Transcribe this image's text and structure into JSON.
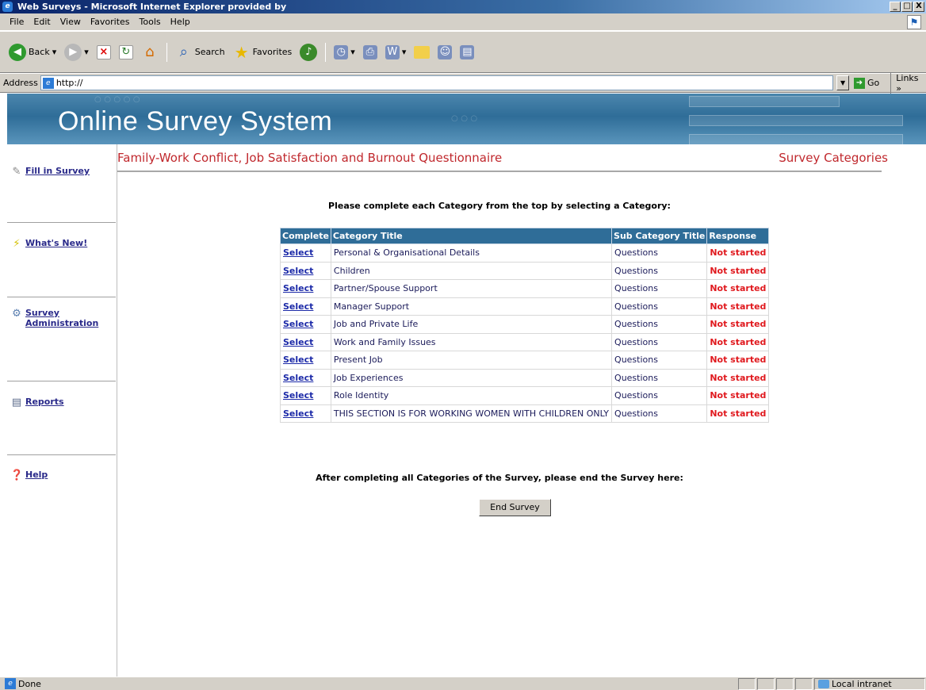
{
  "window": {
    "title": "Web Surveys - Microsoft Internet Explorer provided by",
    "controls": [
      "_",
      "□",
      "X"
    ]
  },
  "menu": [
    "File",
    "Edit",
    "View",
    "Favorites",
    "Tools",
    "Help"
  ],
  "toolbar": {
    "back_label": "Back",
    "search_label": "Search",
    "favorites_label": "Favorites"
  },
  "address": {
    "label": "Address",
    "value": "http://",
    "go_label": "Go",
    "links_label": "Links »"
  },
  "banner": {
    "title": "Online Survey System"
  },
  "sidebar": {
    "items": [
      {
        "label": "Fill in Survey",
        "icon": "pencil-icon"
      },
      {
        "label": "What's New!",
        "icon": "lightning-icon"
      },
      {
        "label": "Survey Administration",
        "icon": "admin-icon"
      },
      {
        "label": "Reports",
        "icon": "report-icon"
      },
      {
        "label": "Help",
        "icon": "help-icon"
      }
    ]
  },
  "content": {
    "survey_title": "Family-Work Conflict, Job Satisfaction and Burnout Questionnaire",
    "section_label": "Survey Categories",
    "instruction": "Please complete each Category from the top by selecting a Category:",
    "end_instruction": "After completing all Categories of the Survey, please end the Survey here:",
    "end_button": "End Survey"
  },
  "table": {
    "headers": [
      "Complete",
      "Category Title",
      "Sub Category Title",
      "Response"
    ],
    "rows": [
      {
        "action": "Select",
        "category": "Personal & Organisational Details",
        "sub": "Questions",
        "status": "Not started"
      },
      {
        "action": "Select",
        "category": "Children",
        "sub": "Questions",
        "status": "Not started"
      },
      {
        "action": "Select",
        "category": "Partner/Spouse Support",
        "sub": "Questions",
        "status": "Not started"
      },
      {
        "action": "Select",
        "category": "Manager Support",
        "sub": "Questions",
        "status": "Not started"
      },
      {
        "action": "Select",
        "category": "Job and Private Life",
        "sub": "Questions",
        "status": "Not started"
      },
      {
        "action": "Select",
        "category": "Work and Family Issues",
        "sub": "Questions",
        "status": "Not started"
      },
      {
        "action": "Select",
        "category": "Present Job",
        "sub": "Questions",
        "status": "Not started"
      },
      {
        "action": "Select",
        "category": "Job Experiences",
        "sub": "Questions",
        "status": "Not started"
      },
      {
        "action": "Select",
        "category": "Role Identity",
        "sub": "Questions",
        "status": "Not started"
      },
      {
        "action": "Select",
        "category": "THIS SECTION IS FOR WORKING WOMEN WITH CHILDREN ONLY",
        "sub": "Questions",
        "status": "Not started"
      }
    ]
  },
  "status": {
    "text": "Done",
    "zone": "Local intranet"
  },
  "colors": {
    "accent_red": "#c0282d",
    "header_blue": "#2f6d98",
    "status_red": "#e0191e"
  }
}
